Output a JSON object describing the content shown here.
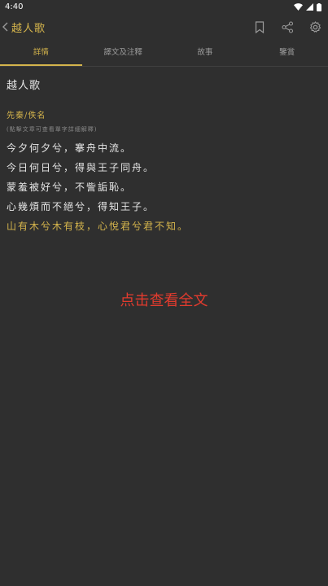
{
  "status_bar": {
    "time": "4:40"
  },
  "app_bar": {
    "title": "越人歌"
  },
  "tabs": [
    {
      "label": "詳情",
      "active": true
    },
    {
      "label": "譯文及注釋",
      "active": false
    },
    {
      "label": "故事",
      "active": false
    },
    {
      "label": "鑒賞",
      "active": false
    }
  ],
  "poem": {
    "title": "越人歌",
    "author": "先秦/佚名",
    "hint": "(點擊文章可查看單字詳細解釋)",
    "lines": [
      "今夕何夕兮，搴舟中流。",
      "今日何日兮，得與王子同舟。",
      "蒙羞被好兮，不訾詬恥。",
      "心幾煩而不絕兮，得知王子。",
      "山有木兮木有枝，心悅君兮君不知。"
    ]
  },
  "read_full_label": "点击查看全文",
  "colors": {
    "background": "#2f2f2f",
    "accent": "#d4b44c",
    "text": "#e6e6e6",
    "link": "#e23b2e"
  }
}
